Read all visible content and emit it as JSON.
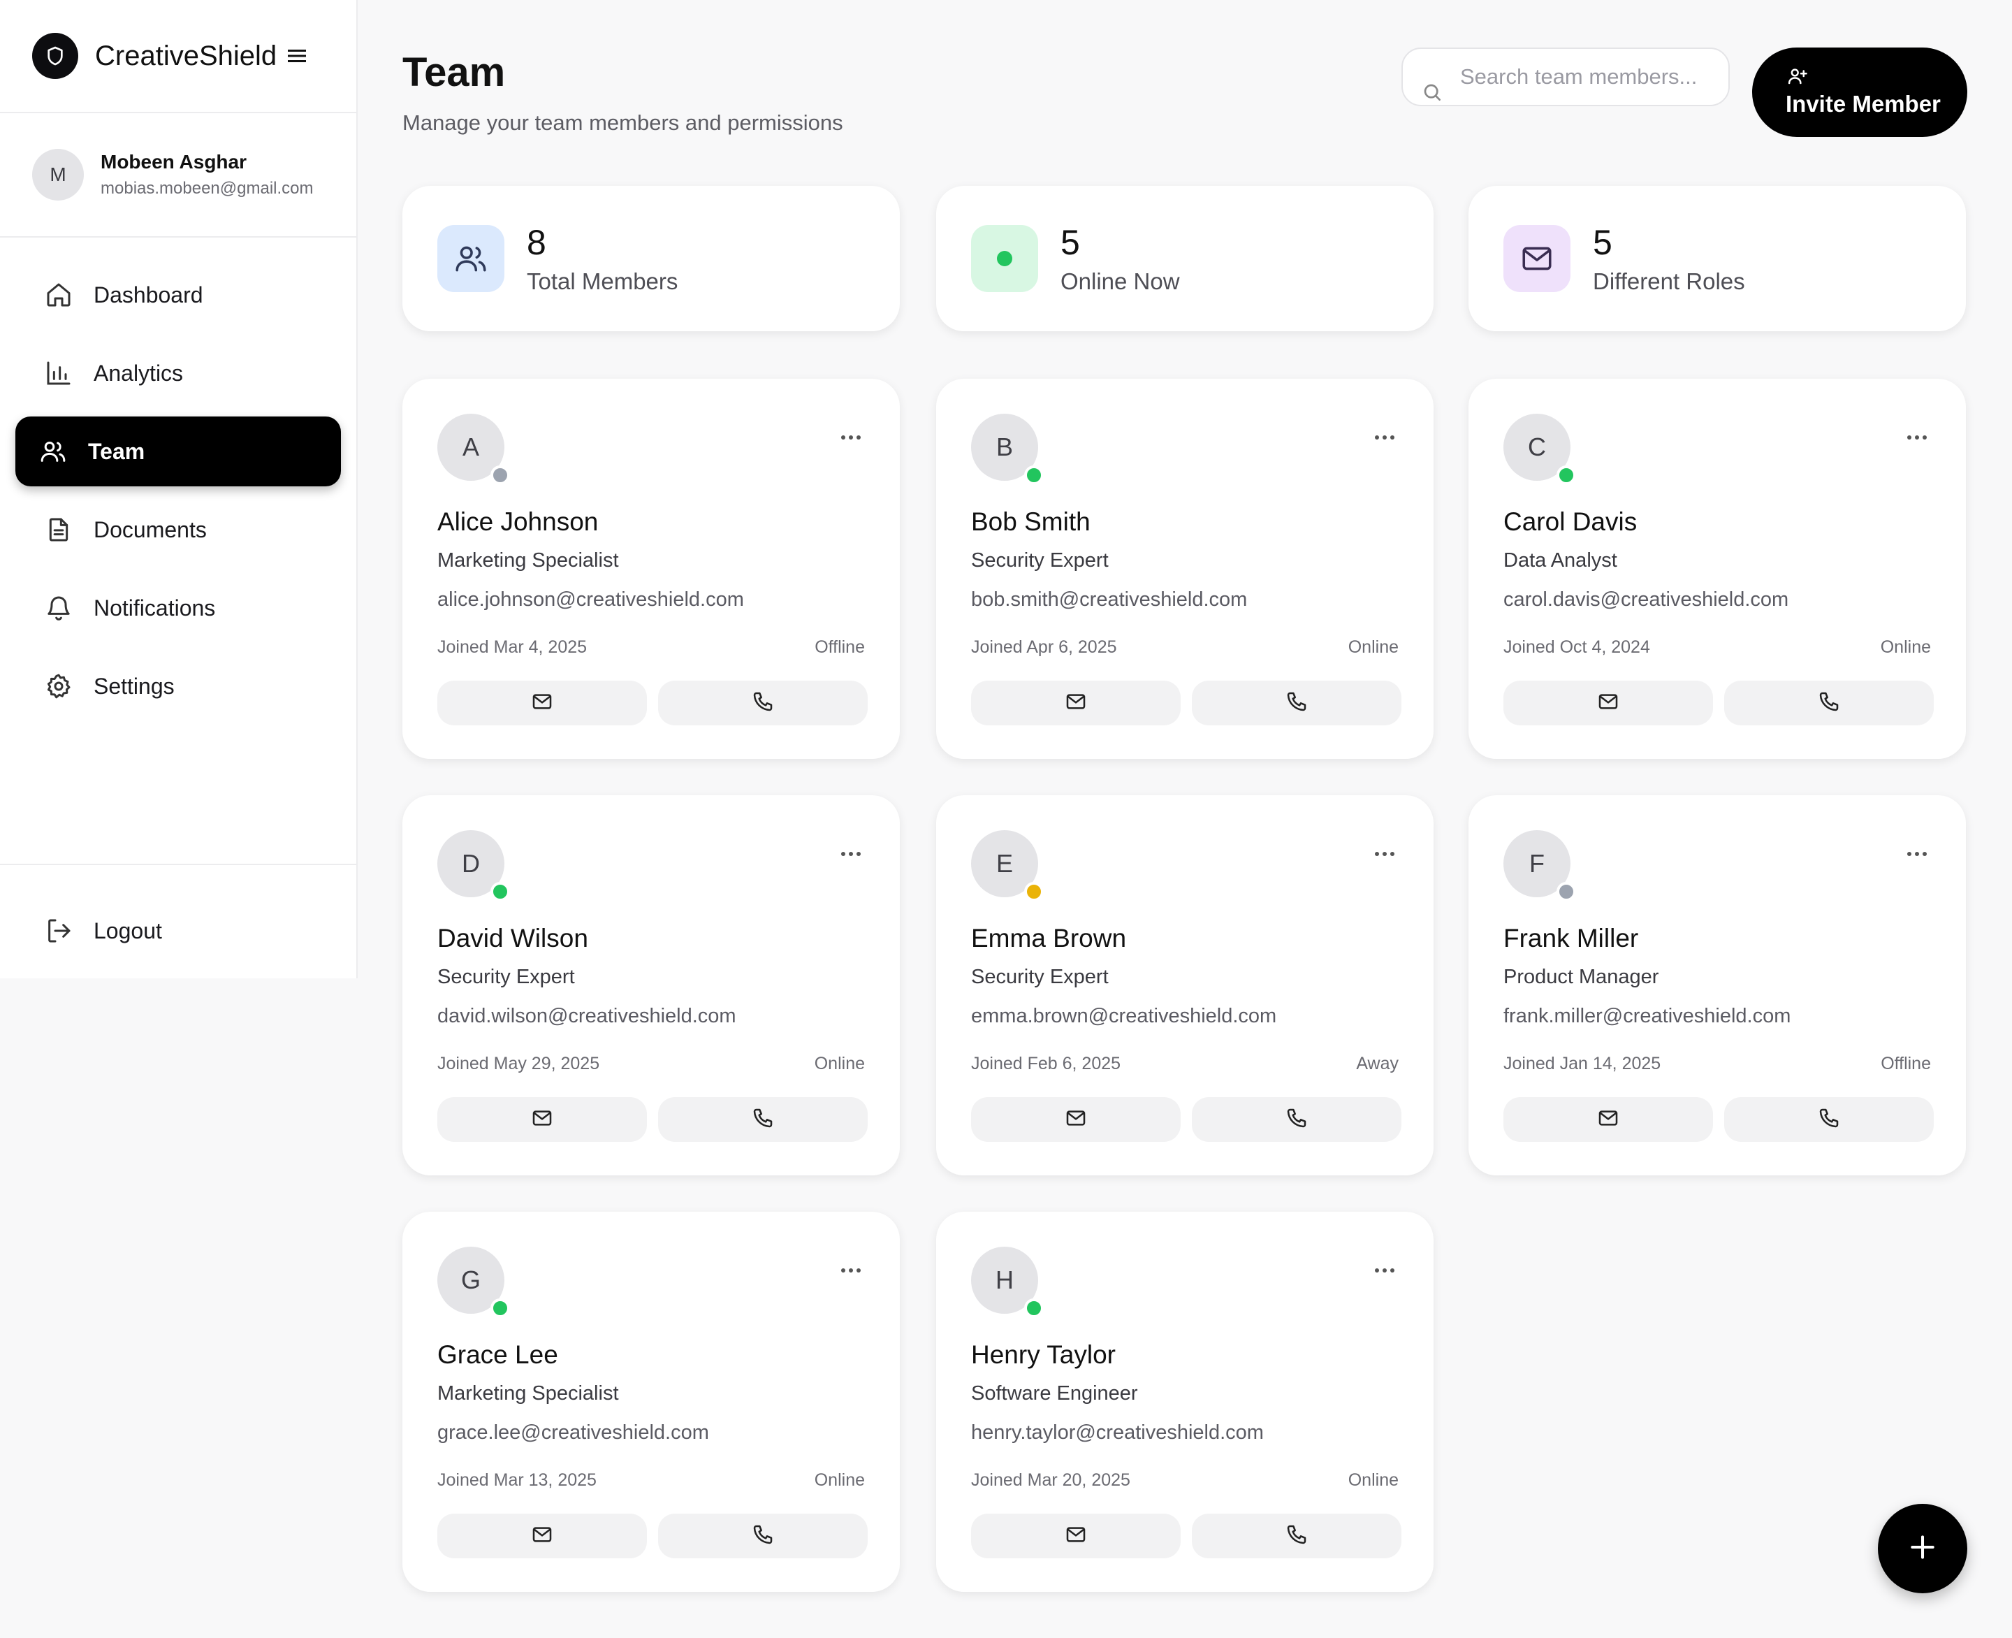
{
  "brand": {
    "name": "CreativeShield"
  },
  "user": {
    "initial": "M",
    "name": "Mobeen Asghar",
    "email": "mobias.mobeen@gmail.com"
  },
  "nav": [
    {
      "label": "Dashboard",
      "icon": "home-icon"
    },
    {
      "label": "Analytics",
      "icon": "bar-chart-icon"
    },
    {
      "label": "Team",
      "icon": "users-icon",
      "active": true
    },
    {
      "label": "Documents",
      "icon": "file-icon"
    },
    {
      "label": "Notifications",
      "icon": "bell-icon"
    },
    {
      "label": "Settings",
      "icon": "gear-icon"
    }
  ],
  "logout": {
    "label": "Logout"
  },
  "header": {
    "title": "Team",
    "subtitle": "Manage your team members and permissions",
    "search_placeholder": "Search team members...",
    "invite_label": "Invite Member"
  },
  "stats": [
    {
      "value": "8",
      "label": "Total Members",
      "icon": "users-icon",
      "color": "#dbe9fd"
    },
    {
      "value": "5",
      "label": "Online Now",
      "icon": "status-dot-icon",
      "color": "#d8f7e3"
    },
    {
      "value": "5",
      "label": "Different Roles",
      "icon": "mail-icon",
      "color": "#efe1fb"
    }
  ],
  "status_colors": {
    "Online": "#22c55e",
    "Away": "#eab308",
    "Offline": "#9ca3af"
  },
  "members": [
    {
      "initial": "A",
      "name": "Alice Johnson",
      "role": "Marketing Specialist",
      "email": "alice.johnson@creativeshield.com",
      "joined": "Joined Mar 4, 2025",
      "status": "Offline"
    },
    {
      "initial": "B",
      "name": "Bob Smith",
      "role": "Security Expert",
      "email": "bob.smith@creativeshield.com",
      "joined": "Joined Apr 6, 2025",
      "status": "Online"
    },
    {
      "initial": "C",
      "name": "Carol Davis",
      "role": "Data Analyst",
      "email": "carol.davis@creativeshield.com",
      "joined": "Joined Oct 4, 2024",
      "status": "Online"
    },
    {
      "initial": "D",
      "name": "David Wilson",
      "role": "Security Expert",
      "email": "david.wilson@creativeshield.com",
      "joined": "Joined May 29, 2025",
      "status": "Online"
    },
    {
      "initial": "E",
      "name": "Emma Brown",
      "role": "Security Expert",
      "email": "emma.brown@creativeshield.com",
      "joined": "Joined Feb 6, 2025",
      "status": "Away"
    },
    {
      "initial": "F",
      "name": "Frank Miller",
      "role": "Product Manager",
      "email": "frank.miller@creativeshield.com",
      "joined": "Joined Jan 14, 2025",
      "status": "Offline"
    },
    {
      "initial": "G",
      "name": "Grace Lee",
      "role": "Marketing Specialist",
      "email": "grace.lee@creativeshield.com",
      "joined": "Joined Mar 13, 2025",
      "status": "Online"
    },
    {
      "initial": "H",
      "name": "Henry Taylor",
      "role": "Software Engineer",
      "email": "henry.taylor@creativeshield.com",
      "joined": "Joined Mar 20, 2025",
      "status": "Online"
    }
  ]
}
